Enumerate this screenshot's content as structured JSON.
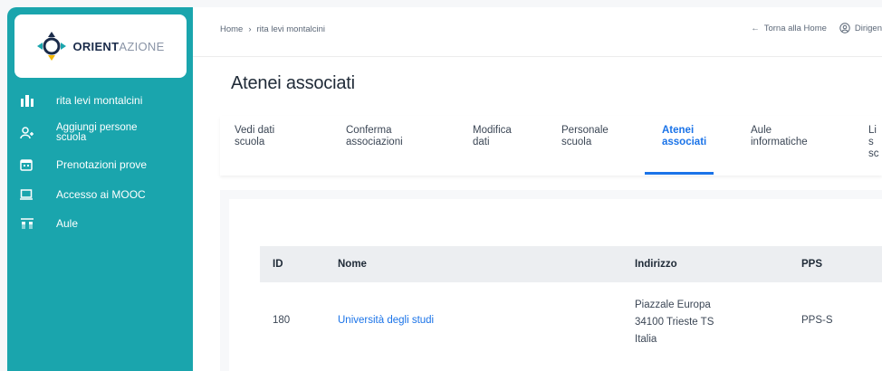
{
  "brand": {
    "name_bold": "ORIENT",
    "name_light": "AZIONE",
    "colors": {
      "sidebar": "#1aa5ad",
      "accent": "#1a73e8"
    }
  },
  "sidebar": {
    "items": [
      {
        "label": "rita levi montalcini",
        "icon": "school-icon"
      },
      {
        "label": "Aggiungi persone scuola",
        "icon": "add-user-icon"
      },
      {
        "label": "Prenotazioni prove",
        "icon": "calendar-icon"
      },
      {
        "label": "Accesso ai MOOC",
        "icon": "laptop-icon"
      },
      {
        "label": "Aule",
        "icon": "classroom-icon"
      }
    ]
  },
  "header": {
    "breadcrumb": [
      "Home",
      "rita levi montalcini"
    ],
    "back_link": "Torna alla Home",
    "user_label": "Dirigen"
  },
  "page": {
    "title": "Atenei associati"
  },
  "tabs": [
    {
      "label": "Vedi dati scuola",
      "active": false
    },
    {
      "label": "Conferma associazioni",
      "active": false
    },
    {
      "label": "Modifica dati",
      "active": false
    },
    {
      "label": "Personale scuola",
      "active": false
    },
    {
      "label": "Atenei associati",
      "active": true
    },
    {
      "label": "Aule informatiche",
      "active": false
    },
    {
      "label": "Lis sc",
      "active": false
    }
  ],
  "table": {
    "columns": [
      "ID",
      "Nome",
      "Indirizzo",
      "PPS"
    ],
    "rows": [
      {
        "id": "180",
        "nome": "Università degli studi",
        "indirizzo": [
          "Piazzale Europa",
          "34100 Trieste TS",
          "Italia"
        ],
        "pps": "PPS-S"
      }
    ]
  }
}
